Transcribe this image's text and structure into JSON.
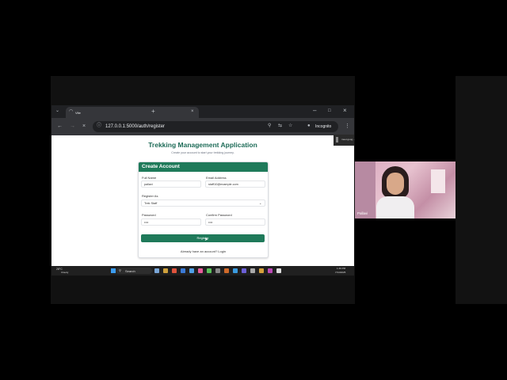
{
  "browser": {
    "tab_title": "Vite",
    "url": "127.0.0.1:5000/auth/register",
    "incognito_label": "Incognito",
    "side_tab_label": "meet.goog..."
  },
  "page": {
    "title": "Trekking Management Application",
    "subtitle": "Create your account to start your trekking journey."
  },
  "form": {
    "header": "Create Account",
    "full_name_label": "Full Name",
    "full_name_value": "pallavi",
    "email_label": "Email Address",
    "email_value": "staff10@example.com",
    "register_as_label": "Register As",
    "register_as_value": "Trek Staff",
    "password_label": "Password",
    "password_value": "••••",
    "confirm_password_label": "Confirm Password",
    "confirm_password_value": "••••",
    "register_button": "Register",
    "login_prompt": "Already have an account? Login"
  },
  "taskbar": {
    "weather": "28°C",
    "weather_desc": "Cloudy",
    "search_label": "Search",
    "time": "1:46 PM",
    "date": "7/14/2025"
  },
  "webcam": {
    "name": "Pallavi"
  },
  "icons": [
    "chevron-down-icon",
    "loading-icon",
    "close-icon",
    "plus-icon",
    "minimize-icon",
    "maximize-icon",
    "back-icon",
    "forward-icon",
    "stop-icon",
    "info-icon",
    "zoom-icon",
    "translate-icon",
    "star-icon",
    "incognito-icon",
    "menu-icon",
    "select-chevron-icon",
    "cursor-icon",
    "windows-icon",
    "search-icon"
  ]
}
